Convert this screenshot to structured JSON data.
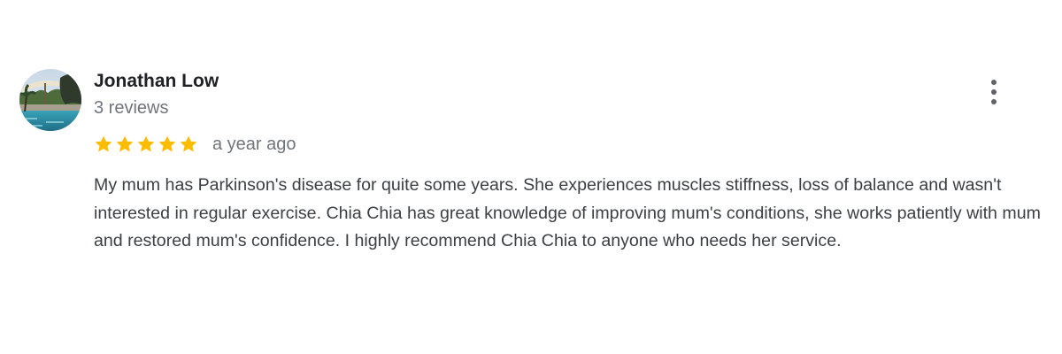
{
  "review": {
    "author": "Jonathan Low",
    "review_count": "3 reviews",
    "rating": 5,
    "rating_max": 5,
    "date": "a year ago",
    "text": "My mum has Parkinson's disease for quite some years. She experiences muscles stiffness, loss of balance and wasn't interested in regular exercise. Chia Chia has great knowledge of improving mum's conditions, she works patiently with mum and restored mum's confidence. I highly recommend Chia Chia to anyone who needs her service."
  },
  "icons": {
    "star": "star-icon",
    "more": "more-vert-icon",
    "avatar": "avatar-photo"
  },
  "colors": {
    "star": "#fbbc04",
    "name": "#202124",
    "secondary_text": "#70757a",
    "body_text": "#3c4043",
    "menu_dots": "#5f6368"
  }
}
